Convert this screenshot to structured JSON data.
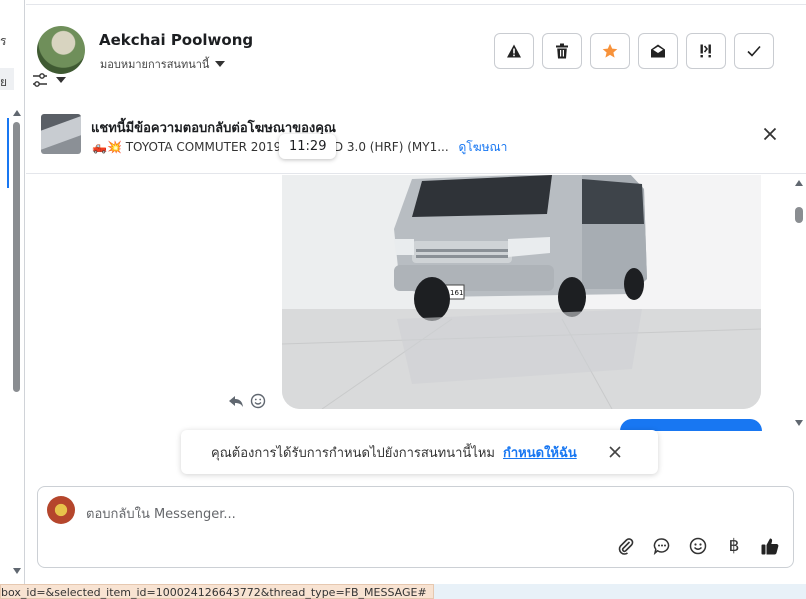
{
  "left_panel": {
    "items": [
      "ร",
      "ย"
    ]
  },
  "header": {
    "contact_name": "Aekchai Poolwong",
    "assign_label": "มอบหมายการสนทนานี้",
    "actions": [
      {
        "name": "report-button",
        "icon": "warning-icon"
      },
      {
        "name": "delete-button",
        "icon": "trash-icon"
      },
      {
        "name": "star-button",
        "icon": "star-icon",
        "color": "#f7923b"
      },
      {
        "name": "mark-unread-button",
        "icon": "envelope-open-icon"
      },
      {
        "name": "follow-up-button",
        "icon": "follow-up-icon"
      },
      {
        "name": "done-button",
        "icon": "check-icon"
      }
    ]
  },
  "ad_banner": {
    "title": "แชทนี้มีข้อความตอบกลับต่อโฆษณาของคุณ",
    "subtitle_prefix": "🛻💥 TOYOTA COMMUTER 2019",
    "subtitle_suffix": "D4D 3.0 (HRF) (MY1...",
    "link": "ดูโฆษณา",
    "time": "11:29"
  },
  "conversation": {
    "plate_text": "ฮด 1161",
    "accent": "#1877f2"
  },
  "assign_prompt": {
    "text": "คุณต้องการได้รับการกำหนดไปยังการสนทนานี้ไหม",
    "link": "กำหนดให้ฉัน"
  },
  "composer": {
    "placeholder": "ตอบกลับใน Messenger...",
    "tools": [
      "attach-icon",
      "chat-bubble-icon",
      "emoji-icon",
      "baht-icon",
      "thumbs-up-icon"
    ],
    "baht_symbol": "฿"
  },
  "status_bar": {
    "url": "box_id=&selected_item_id=100024126643772&thread_type=FB_MESSAGE#"
  }
}
